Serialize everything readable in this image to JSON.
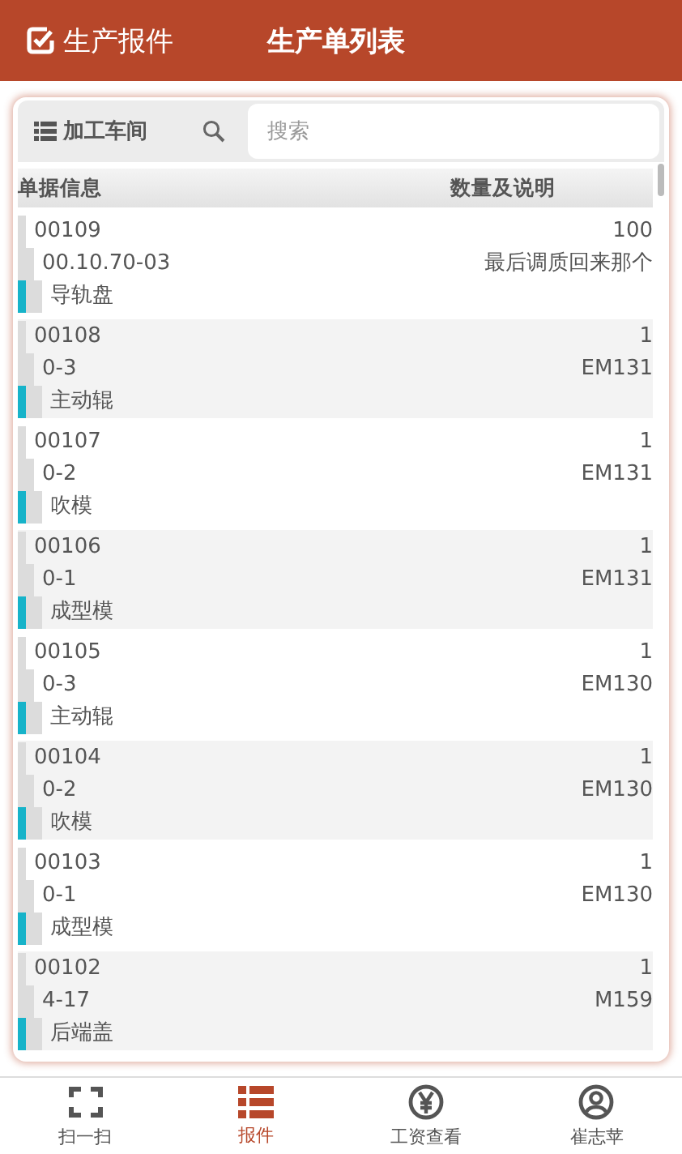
{
  "header": {
    "app_title": "生产报件",
    "page_title": "生产单列表"
  },
  "toolbar": {
    "workshop_button": "加工车间",
    "search": {
      "placeholder": "搜索"
    }
  },
  "table": {
    "columns": [
      "单据信息",
      "数量及说明"
    ],
    "rows": [
      {
        "number": "00109",
        "code": "00.10.70-03",
        "name": "导轨盘",
        "quantity": "100",
        "note": "最后调质回来那个"
      },
      {
        "number": "00108",
        "code": "0-3",
        "name": "主动辊",
        "quantity": "1",
        "note": "EM131"
      },
      {
        "number": "00107",
        "code": "0-2",
        "name": "吹模",
        "quantity": "1",
        "note": "EM131"
      },
      {
        "number": "00106",
        "code": "0-1",
        "name": "成型模",
        "quantity": "1",
        "note": "EM131"
      },
      {
        "number": "00105",
        "code": "0-3",
        "name": "主动辊",
        "quantity": "1",
        "note": "EM130"
      },
      {
        "number": "00104",
        "code": "0-2",
        "name": "吹模",
        "quantity": "1",
        "note": "EM130"
      },
      {
        "number": "00103",
        "code": "0-1",
        "name": "成型模",
        "quantity": "1",
        "note": "EM130"
      },
      {
        "number": "00102",
        "code": "4-17",
        "name": "后端盖",
        "quantity": "1",
        "note": "M159"
      }
    ]
  },
  "tabbar": [
    {
      "label": "扫一扫",
      "kind": "scan",
      "selected": false
    },
    {
      "label": "报件",
      "kind": "list",
      "selected": true
    },
    {
      "label": "工资查看",
      "kind": "yen",
      "selected": false
    },
    {
      "label": "崔志苹",
      "kind": "user",
      "selected": false
    }
  ]
}
